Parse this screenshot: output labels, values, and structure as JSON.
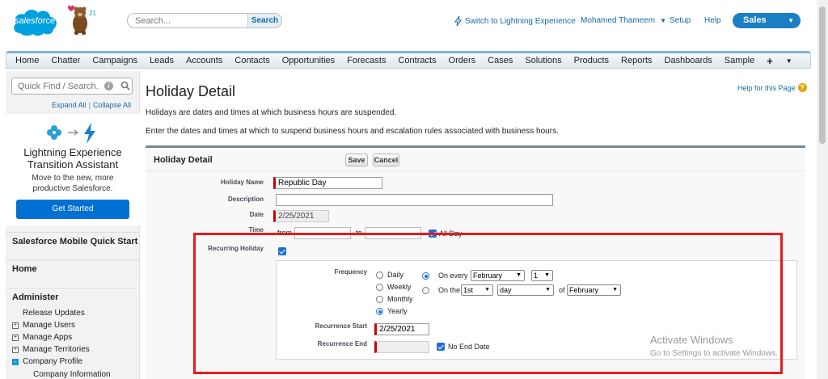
{
  "header": {
    "logo_text": "salesforce",
    "release": "21",
    "search_placeholder": "Search...",
    "search_button": "Search",
    "lightning_link": "Switch to Lightning Experience",
    "user_name": "Mohamed Thameem",
    "setup": "Setup",
    "help": "Help",
    "app_name": "Sales"
  },
  "tabs": [
    "Home",
    "Chatter",
    "Campaigns",
    "Leads",
    "Accounts",
    "Contacts",
    "Opportunities",
    "Forecasts",
    "Contracts",
    "Orders",
    "Cases",
    "Solutions",
    "Products",
    "Reports",
    "Dashboards",
    "Sample"
  ],
  "tab_plus": "+",
  "sidebar": {
    "quickfind_placeholder": "Quick Find / Search...",
    "expand_all": "Expand All",
    "separator": "|",
    "collapse_all": "Collapse All",
    "lex_title": "Lightning Experience Transition Assistant",
    "lex_desc": "Move to the new, more productive Salesforce.",
    "get_started": "Get Started",
    "mobile_quick_start": "Salesforce Mobile Quick Start",
    "home": "Home",
    "administer": "Administer",
    "release_updates": "Release Updates",
    "manage_users": "Manage Users",
    "manage_apps": "Manage Apps",
    "manage_territories": "Manage Territories",
    "company_profile": "Company Profile",
    "company_information": "Company Information"
  },
  "page": {
    "title": "Holiday Detail",
    "help_link": "Help for this Page",
    "intro1": "Holidays are dates and times at which business hours are suspended.",
    "intro2": "Enter the dates and times at which to suspend business hours and escalation rules associated with business hours."
  },
  "panel": {
    "title": "Holiday Detail",
    "save": "Save",
    "cancel": "Cancel",
    "holiday_name_label": "Holiday Name",
    "holiday_name_value": "Republic Day",
    "description_label": "Description",
    "date_label": "Date",
    "date_value": "2/25/2021",
    "time_label": "Time",
    "from": "from",
    "to": "to",
    "all_day": "All Day",
    "recurring_label": "Recurring Holiday",
    "frequency_label": "Frequency",
    "freq_options": [
      "Daily",
      "Weekly",
      "Monthly",
      "Yearly"
    ],
    "freq_selected": "Yearly",
    "on_every": "On every",
    "on_every_month": "February",
    "on_every_day": "1",
    "on_the": "On the",
    "on_the_ordinal": "1st",
    "on_the_day": "day",
    "of": "of",
    "on_the_month": "February",
    "recurrence_start_label": "Recurrence Start",
    "recurrence_start_value": "2/25/2021",
    "recurrence_end_label": "Recurrence End",
    "no_end_date": "No End Date"
  },
  "watermark": {
    "line1": "Activate Windows",
    "line2": "Go to Settings to activate Windows."
  },
  "colors": {
    "brand": "#00a1e0",
    "accent": "#1f6ed4",
    "highlight": "#e51c1c"
  }
}
